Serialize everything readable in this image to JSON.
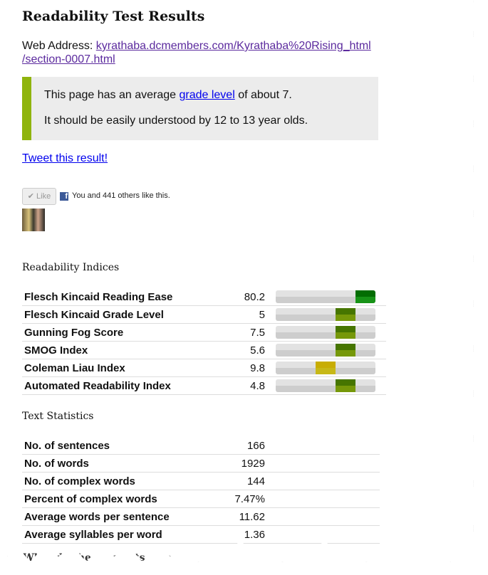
{
  "title": "Readability Test Results",
  "address": {
    "label": "Web Address: ",
    "url": "kyrathaba.dcmembers.com/Kyrathaba%20Rising_html/section-0007.html",
    "url_line1": "kyrathaba.dcmembers.com/Kyrathaba%20Rising_html",
    "url_line2": "/section-0007.html"
  },
  "summary": {
    "pre": "This page has an average ",
    "link": "grade level",
    "post": " of about 7.",
    "line2": "It should be easily understood by 12 to 13 year olds."
  },
  "tweet": "Tweet this result!",
  "facebook": {
    "like": "✔ Like",
    "text": "You and 441 others like this.",
    "icon": "f"
  },
  "indices_heading": "Readability Indices",
  "indices": [
    {
      "name": "Flesch Kincaid Reading Ease",
      "value": "80.2",
      "segment": 4,
      "color": "#1aa71a"
    },
    {
      "name": "Flesch Kincaid Grade Level",
      "value": "5",
      "segment": 3,
      "color": "#86ad0a"
    },
    {
      "name": "Gunning Fog Score",
      "value": "7.5",
      "segment": 3,
      "color": "#86ad0a"
    },
    {
      "name": "SMOG Index",
      "value": "5.6",
      "segment": 3,
      "color": "#86ad0a"
    },
    {
      "name": "Coleman Liau Index",
      "value": "9.8",
      "segment": 2,
      "color": "#e2d21a"
    },
    {
      "name": "Automated Readability Index",
      "value": "4.8",
      "segment": 3,
      "color": "#86ad0a"
    }
  ],
  "stats_heading": "Text Statistics",
  "stats": [
    {
      "name": "No. of sentences",
      "value": "166"
    },
    {
      "name": "No. of words",
      "value": "1929"
    },
    {
      "name": "No. of complex words",
      "value": "144"
    },
    {
      "name": "Percent of complex words",
      "value": "7.47%"
    },
    {
      "name": "Average words per sentence",
      "value": "11.62"
    },
    {
      "name": "Average syllables per word",
      "value": "1.36"
    }
  ],
  "footer_heading": "What do these results mean?"
}
